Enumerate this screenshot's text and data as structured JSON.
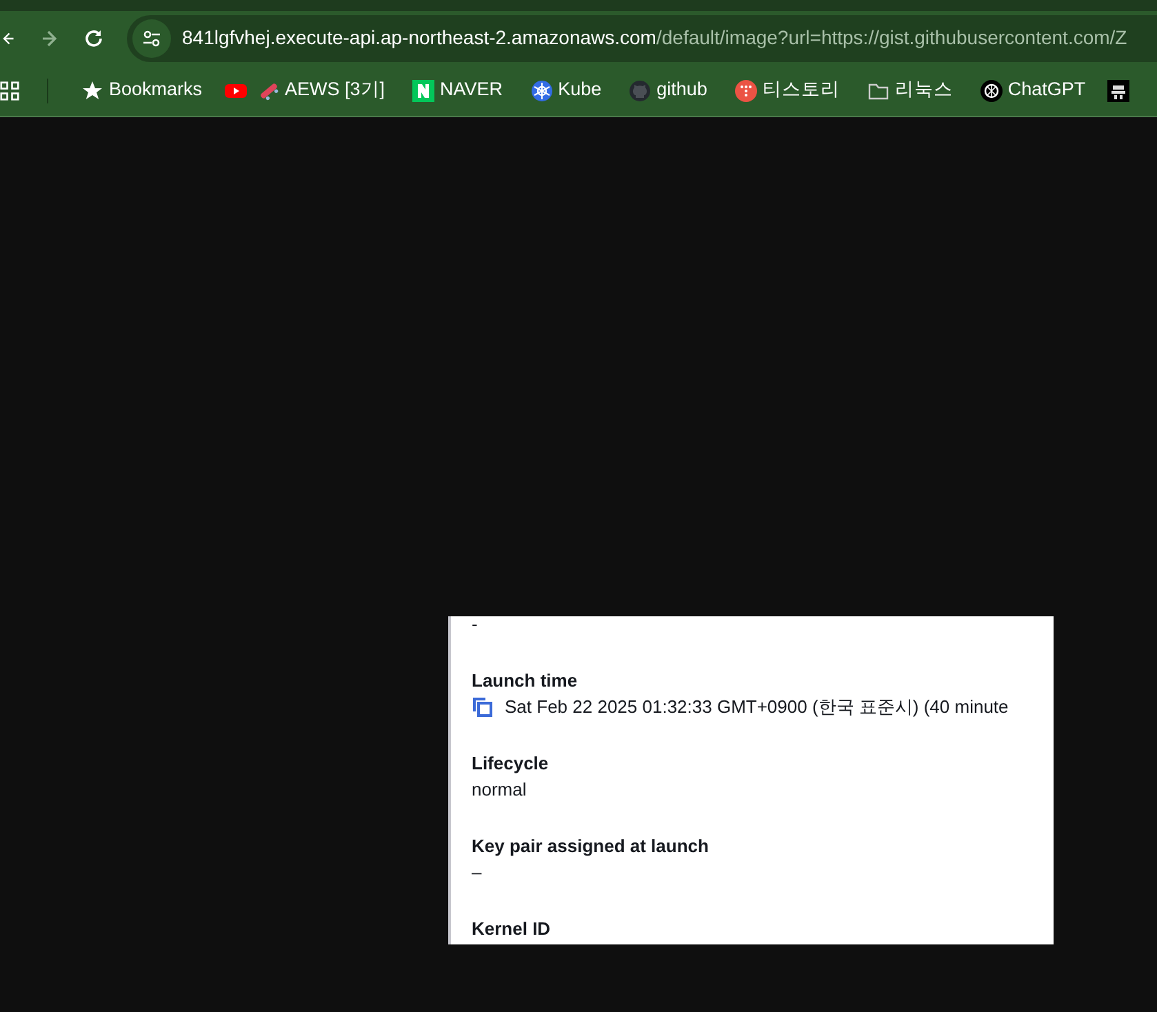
{
  "browser": {
    "url_host": "841lgfvhej.execute-api.ap-northeast-2.amazonaws.com",
    "url_path": "/default/image?url=https://gist.githubusercontent.com/Z",
    "bookmarks": [
      {
        "kind": "star",
        "label": "Bookmarks"
      },
      {
        "kind": "youtube"
      },
      {
        "kind": "skateboard",
        "label": "AEWS [3기]"
      },
      {
        "kind": "naver",
        "label": "NAVER"
      },
      {
        "kind": "kube",
        "label": "Kube"
      },
      {
        "kind": "github",
        "label": "github"
      },
      {
        "kind": "tistory",
        "label": "티스토리"
      },
      {
        "kind": "folder",
        "label": "리눅스"
      },
      {
        "kind": "chatgpt",
        "label": "ChatGPT"
      },
      {
        "kind": "app"
      }
    ]
  },
  "image": {
    "fields": [
      {
        "value": "-",
        "copyable": false
      },
      {
        "label": "Launch time",
        "value": "Sat Feb 22 2025 01:32:33 GMT+0900 (한국 표준시) (40 minute",
        "copyable": true
      },
      {
        "label": "Lifecycle",
        "value": "normal",
        "copyable": false
      },
      {
        "label": "Key pair assigned at launch",
        "value": "–",
        "copyable": false
      },
      {
        "label": "Kernel ID"
      }
    ]
  }
}
